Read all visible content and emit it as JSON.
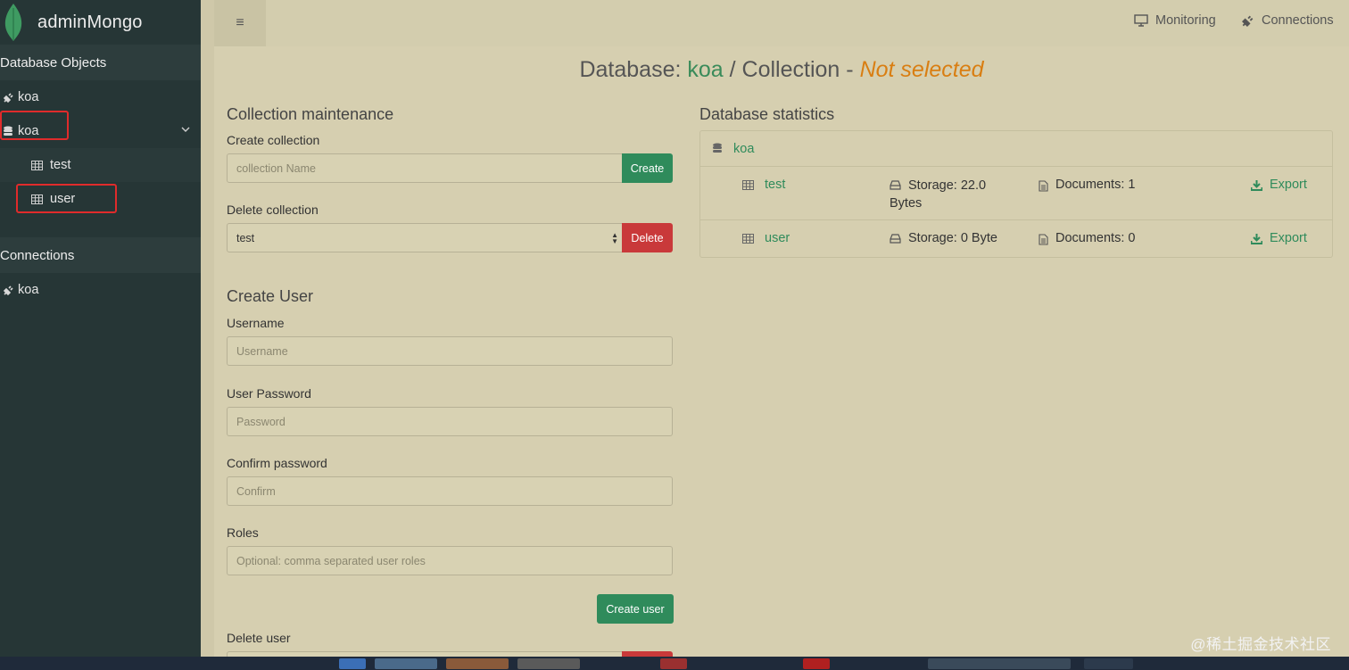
{
  "app": {
    "name": "adminMongo"
  },
  "sidebar": {
    "db_objects_header": "Database Objects",
    "db_objects": [
      {
        "label": "koa",
        "icon": "plug-icon"
      }
    ],
    "database": {
      "label": "koa",
      "icon": "database-icon",
      "expanded": true
    },
    "collections": [
      {
        "label": "test",
        "icon": "table-icon"
      },
      {
        "label": "user",
        "icon": "table-icon"
      }
    ],
    "connections_header": "Connections",
    "connections": [
      {
        "label": "koa",
        "icon": "plug-icon"
      }
    ]
  },
  "topbar": {
    "menu_icon": "hamburger-icon",
    "monitoring": "Monitoring",
    "connections": "Connections"
  },
  "title": {
    "prefix": "Database:",
    "db": "koa",
    "middle": "/ Collection -",
    "collection": "Not selected"
  },
  "maintenance": {
    "heading": "Collection maintenance",
    "create_label": "Create collection",
    "create_placeholder": "collection Name",
    "create_button": "Create",
    "delete_label": "Delete collection",
    "delete_selected": "test",
    "delete_button": "Delete"
  },
  "create_user": {
    "heading": "Create User",
    "username_label": "Username",
    "username_placeholder": "Username",
    "password_label": "User Password",
    "password_placeholder": "Password",
    "confirm_label": "Confirm password",
    "confirm_placeholder": "Confirm",
    "roles_label": "Roles",
    "roles_placeholder": "Optional: comma separated user roles",
    "submit_button": "Create user"
  },
  "delete_user": {
    "label": "Delete user"
  },
  "stats": {
    "heading": "Database statistics",
    "db": "koa",
    "rows": [
      {
        "name": "test",
        "storage_line1": "Storage: 22.0",
        "storage_line2": "Bytes",
        "documents": "Documents: 1",
        "export": "Export"
      },
      {
        "name": "user",
        "storage_line1": "Storage: 0 Byte",
        "storage_line2": "",
        "documents": "Documents: 0",
        "export": "Export"
      }
    ]
  },
  "watermark": "@稀土掘金技术社区",
  "colors": {
    "accent_green": "#2f8b5b",
    "danger_red": "#c9393a",
    "warning_orange": "#d97e12",
    "sidebar_bg": "#263636"
  }
}
